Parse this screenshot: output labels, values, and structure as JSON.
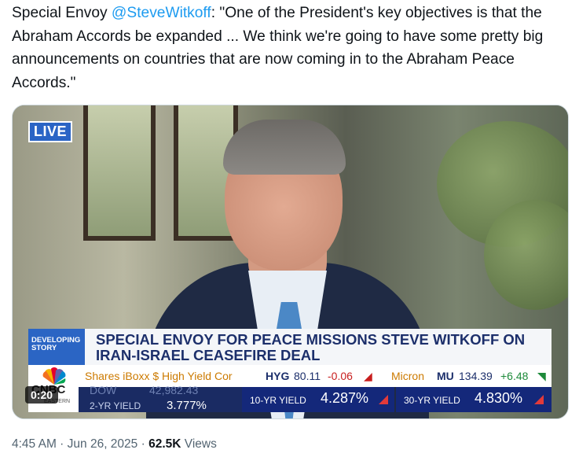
{
  "tweet": {
    "prefix": "Special Envoy ",
    "mention": "@SteveWitkoff",
    "body": ": \"One of the President's key objectives is that the Abraham Accords be expanded ... We think we're going to have some pretty big announcements on countries that are now coming in to the Abraham Peace Accords.\""
  },
  "video": {
    "live_label": "LIVE",
    "time": "0:20",
    "developing": "DEVELOPING STORY",
    "headline": "SPECIAL ENVOY FOR PEACE MISSIONS STEVE WITKOFF ON IRAN-ISRAEL CEASEFIRE DEAL",
    "ticker1": {
      "item1": "Shares iBoxx $ High Yield Cor",
      "sym1": "HYG",
      "price1": "80.11",
      "chg1": "-0.06",
      "item2": "Micron",
      "sym2": "MU",
      "price2": "134.39",
      "chg2": "+6.48"
    },
    "logo": "CNBC",
    "logo_sub": "EASTERN",
    "ticker2": {
      "dow_label": "DOW",
      "dow_value": "42,982.43",
      "yield2_label": "2-YR YIELD",
      "yield2_value": "3.777%"
    },
    "yield10": {
      "label": "10-YR YIELD",
      "value": "4.287%"
    },
    "yield30": {
      "label": "30-YR YIELD",
      "value": "4.830%"
    },
    "colors": {
      "live_bg": "#2a64c5",
      "headline_text": "#1c2f6b",
      "down": "#e23a3a",
      "up": "#1d8a3a"
    }
  },
  "meta": {
    "time": "4:45 AM",
    "sep": " · ",
    "date": "Jun 26, 2025",
    "views_count": "62.5K",
    "views_label": " Views"
  }
}
